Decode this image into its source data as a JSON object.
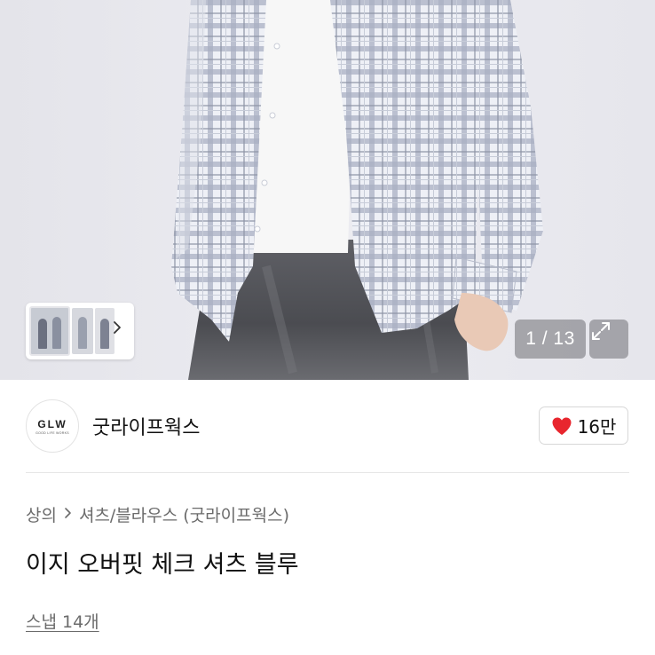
{
  "gallery": {
    "counter": "1 / 13",
    "current": 1,
    "total": 13
  },
  "brand": {
    "logo_text": "GLW",
    "logo_subtext": "GOOD LIFE WORKS",
    "name": "굿라이프웍스"
  },
  "like": {
    "count": "16만",
    "color": "#e8262e"
  },
  "breadcrumb": {
    "items": [
      "상의",
      "셔츠/블라우스 (굿라이프웍스)"
    ]
  },
  "product": {
    "title": "이지 오버핏 체크 셔츠 블루",
    "snap_link": "스냅 14개"
  },
  "icons": {
    "thumb_next": "chevron-right-icon",
    "expand": "expand-icon",
    "like": "heart-icon"
  }
}
